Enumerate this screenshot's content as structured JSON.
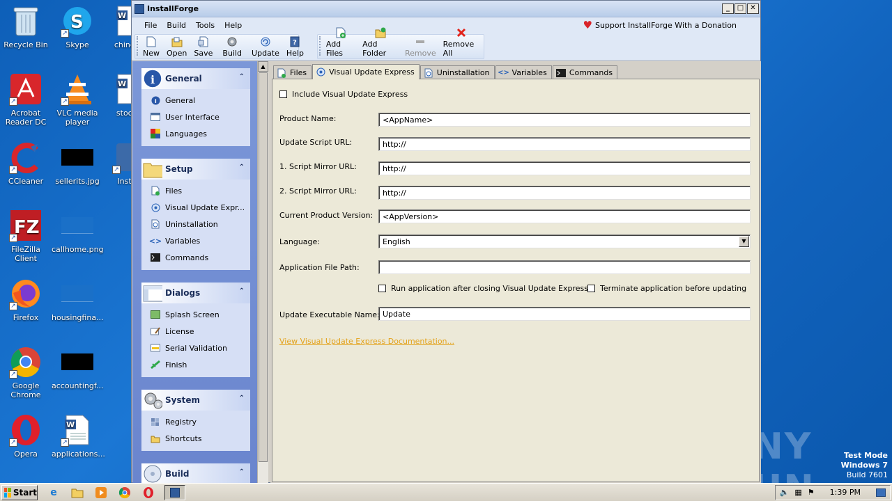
{
  "desktop": {
    "icons": [
      {
        "label": "Recycle Bin",
        "icon": "recycle-bin-icon"
      },
      {
        "label": "Skype",
        "icon": "skype-icon"
      },
      {
        "label": "chinese",
        "icon": "word-doc-icon"
      },
      {
        "label": "Acrobat Reader DC",
        "icon": "acrobat-icon"
      },
      {
        "label": "VLC media player",
        "icon": "vlc-icon"
      },
      {
        "label": "stockg",
        "icon": "word-doc-icon"
      },
      {
        "label": "CCleaner",
        "icon": "ccleaner-icon"
      },
      {
        "label": "sellerits.jpg",
        "icon": "image-file-icon"
      },
      {
        "label": "Install",
        "icon": "installforge-icon"
      },
      {
        "label": "FileZilla Client",
        "icon": "filezilla-icon"
      },
      {
        "label": "callhome.png",
        "icon": "image-file-icon"
      },
      {
        "label": "Firefox",
        "icon": "firefox-icon"
      },
      {
        "label": "housingfina...",
        "icon": "image-file-icon"
      },
      {
        "label": "Google Chrome",
        "icon": "chrome-icon"
      },
      {
        "label": "accountingf...",
        "icon": "image-file-icon"
      },
      {
        "label": "Opera",
        "icon": "opera-icon"
      },
      {
        "label": "applications...",
        "icon": "word-doc-icon"
      }
    ],
    "watermark": "ANY RUN",
    "testmode": {
      "line1": "Test Mode",
      "line2": "Windows 7",
      "line3": "Build 7601"
    }
  },
  "window": {
    "title": "InstallForge",
    "menu": [
      "File",
      "Build",
      "Tools",
      "Help"
    ],
    "donate": "Support InstallForge With a Donation",
    "toolbar1": [
      {
        "label": "New",
        "icon": "new-file-icon"
      },
      {
        "label": "Open",
        "icon": "open-icon"
      },
      {
        "label": "Save",
        "icon": "save-icon"
      },
      {
        "label": "Build",
        "icon": "build-gear-icon"
      },
      {
        "label": "Update",
        "icon": "update-icon"
      },
      {
        "label": "Help",
        "icon": "help-icon"
      }
    ],
    "toolbar2": [
      {
        "label": "Add Files",
        "icon": "add-files-icon"
      },
      {
        "label": "Add Folder",
        "icon": "add-folder-icon"
      },
      {
        "label": "Remove",
        "icon": "remove-icon",
        "disabled": true
      },
      {
        "label": "Remove All",
        "icon": "remove-all-icon"
      }
    ]
  },
  "sidebar": {
    "groups": [
      {
        "title": "General",
        "items": [
          "General",
          "User Interface",
          "Languages"
        ]
      },
      {
        "title": "Setup",
        "items": [
          "Files",
          "Visual Update Expr...",
          "Uninstallation",
          "Variables",
          "Commands"
        ]
      },
      {
        "title": "Dialogs",
        "items": [
          "Splash Screen",
          "License",
          "Serial Validation",
          "Finish"
        ]
      },
      {
        "title": "System",
        "items": [
          "Registry",
          "Shortcuts"
        ]
      },
      {
        "title": "Build",
        "items": []
      }
    ]
  },
  "tabs": [
    "Files",
    "Visual Update Express",
    "Uninstallation",
    "Variables",
    "Commands"
  ],
  "form": {
    "include_label": "Include Visual Update Express",
    "product_name_label": "Product Name:",
    "product_name_value": "<AppName>",
    "update_url_label": "Update Script URL:",
    "update_url_value": "http://",
    "mirror1_label": "1. Script Mirror URL:",
    "mirror1_value": "http://",
    "mirror2_label": "2. Script Mirror URL:",
    "mirror2_value": "http://",
    "version_label": "Current Product Version:",
    "version_value": "<AppVersion>",
    "language_label": "Language:",
    "language_value": "English",
    "app_path_label": "Application File Path:",
    "app_path_value": "",
    "run_after_label": "Run application after closing Visual Update Express",
    "terminate_label": "Terminate application before updating",
    "exe_name_label": "Update Executable Name:",
    "exe_name_value": "Update",
    "doc_link": "View Visual Update Express Documentation..."
  },
  "taskbar": {
    "start": "Start",
    "clock": "1:39 PM"
  }
}
